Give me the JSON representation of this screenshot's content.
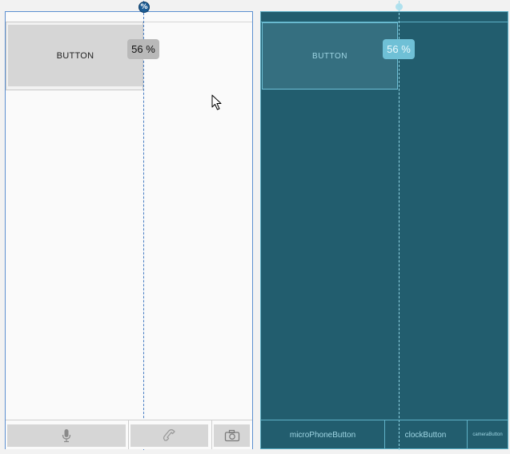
{
  "design_view": {
    "button_label": "BUTTON",
    "guide_handle_symbol": "%",
    "percent_badge": "56 %",
    "bottom_bar": [
      {
        "icon": "microphone-icon"
      },
      {
        "icon": "phone-icon"
      },
      {
        "icon": "camera-icon"
      }
    ]
  },
  "blueprint_view": {
    "button_label": "BUTTON",
    "percent_badge": "56 %",
    "bottom_bar": [
      {
        "label": "microPhoneButton"
      },
      {
        "label": "clockButton"
      },
      {
        "label": "cameraButton"
      }
    ]
  },
  "guide_percent": 56,
  "colors": {
    "design_bg": "#fafafa",
    "design_border": "#5b8fd0",
    "blueprint_bg": "#225d6e",
    "blueprint_line": "#5fb1c7",
    "badge_design": "#b9b9b9",
    "badge_blueprint": "#6fc0d6"
  }
}
